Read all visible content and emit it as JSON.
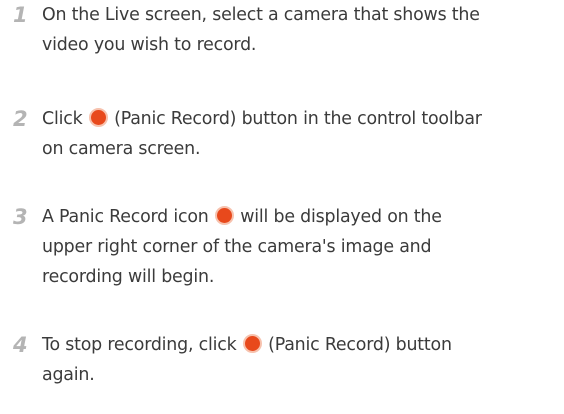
{
  "colors": {
    "step_number": "#b4b4b4",
    "body_text": "#3b3b3b",
    "panic_record_icon": "#e8491c"
  },
  "steps": [
    {
      "number": "1",
      "line1": "On the Live screen, select a camera that shows the",
      "line2": "video you wish to record."
    },
    {
      "number": "2",
      "line1_a": "Click ",
      "line1_b": " (Panic Record) button in the control toolbar",
      "line2": "on camera screen."
    },
    {
      "number": "3",
      "line1_a": "A Panic Record icon ",
      "line1_b": " will be displayed on the",
      "line2": "upper right corner of the camera's image and",
      "line3": "recording will begin."
    },
    {
      "number": "4",
      "line1_a": "To stop recording, click ",
      "line1_b": " (Panic Record) button",
      "line2": "again."
    }
  ],
  "icon": "panic-record-icon"
}
